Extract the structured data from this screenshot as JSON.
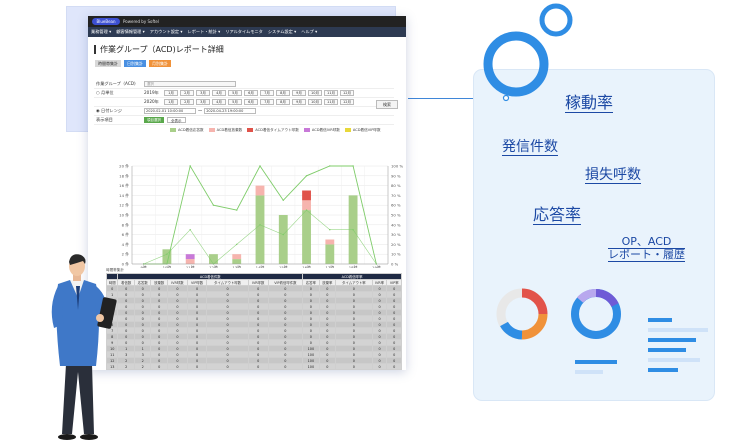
{
  "app": {
    "logo": "BlueBean",
    "title_tail": "Powered by Softel",
    "menu": [
      "業務管理 ▾",
      "顧客情報管理 ▾",
      "アカウント設定 ▾",
      "レポート・統計 ▾",
      "リアルタイムモニタ",
      "システム設定 ▾",
      "ヘルプ ▾"
    ]
  },
  "page": {
    "title": "作業グループ（ACD)レポート詳細",
    "buttons": {
      "time_agg": "時間帯集計",
      "daily_agg": "日別集計",
      "monthly_agg": "月別集計"
    }
  },
  "filter": {
    "group_label": "作業グループ（ACD)",
    "group_select_placeholder": "選択",
    "month_label": "月単位",
    "year1": "2019年",
    "year2": "2020年",
    "months": [
      "1月",
      "2月",
      "3月",
      "4月",
      "5月",
      "6月",
      "7月",
      "8月",
      "9月",
      "10月",
      "11月",
      "12月"
    ],
    "range_label": "日付レンジ",
    "range_from": "2020-02-01 10:00:00",
    "range_sep": "～",
    "range_to": "2020-04-23 19:00:00",
    "display_label": "表示項目",
    "select_btn": "項目選択",
    "all_btn": "全表示",
    "search_btn": "検索"
  },
  "chart_data": {
    "type": "bar",
    "categories": [
      "9時",
      "10時",
      "11時",
      "12時",
      "13時",
      "14時",
      "15時",
      "16時",
      "17時",
      "18時",
      "19時"
    ],
    "series": [
      {
        "name": "ACD着信応答数",
        "values": [
          0,
          3,
          0,
          2,
          1,
          14,
          10,
          11,
          4,
          14,
          0
        ]
      },
      {
        "name": "ACD着信放棄数",
        "values": [
          0,
          0,
          1,
          0,
          1,
          2,
          0,
          2,
          1,
          0,
          0
        ]
      },
      {
        "name": "ACD着信タイムアウト呼数",
        "values": [
          0,
          0,
          0,
          0,
          0,
          0,
          0,
          2,
          0,
          0,
          0
        ]
      },
      {
        "name": "ACD着信IVR呼数",
        "values": [
          0,
          0,
          1,
          0,
          0,
          0,
          0,
          0,
          0,
          0,
          0
        ]
      },
      {
        "name": "ACD着信VIP呼数",
        "values": [
          0,
          0,
          0,
          0,
          0,
          0,
          0,
          0,
          0,
          0,
          0
        ]
      }
    ],
    "ylim_left": [
      0,
      20
    ],
    "y_ticks_left": [
      "0 件",
      "2 件",
      "4 件",
      "6 件",
      "8 件",
      "10 件",
      "12 件",
      "14 件",
      "16 件",
      "18 件",
      "20 件"
    ],
    "ylim_right": [
      0,
      100
    ],
    "y_ticks_right": [
      "0 %",
      "10 %",
      "20 %",
      "30 %",
      "40 %",
      "50 %",
      "60 %",
      "70 %",
      "80 %",
      "90 %",
      "100 %"
    ],
    "rate_lines": [
      {
        "values": [
          0,
          0,
          100,
          60,
          55,
          100,
          65,
          90,
          100,
          100,
          0
        ]
      },
      {
        "values": [
          0,
          10,
          35,
          0,
          20,
          40,
          30,
          55,
          35,
          35,
          0
        ]
      }
    ],
    "grid": true,
    "legend": "top"
  },
  "table": {
    "caption": "時間帯集計",
    "group1": "ACD着信件数",
    "group2": "ACD着信呼率",
    "headers": [
      "時間",
      "着信数",
      "応答数",
      "放棄数",
      "IVR呼数",
      "VIP呼数",
      "タイムアウト呼数",
      "IVR呼数",
      "VIP着信呼件数",
      "応答率",
      "放棄率",
      "タイムアウト率",
      "IVR率",
      "VIP率"
    ],
    "rows": [
      [
        "0",
        "0",
        "0",
        "0",
        "0",
        "0",
        "0",
        "0",
        "0",
        "0",
        "0",
        "0",
        "0",
        "0"
      ],
      [
        "1",
        "0",
        "0",
        "0",
        "0",
        "0",
        "0",
        "0",
        "0",
        "0",
        "0",
        "0",
        "0",
        "0"
      ],
      [
        "2",
        "0",
        "0",
        "0",
        "0",
        "0",
        "0",
        "0",
        "0",
        "0",
        "0",
        "0",
        "0",
        "0"
      ],
      [
        "3",
        "0",
        "0",
        "0",
        "0",
        "0",
        "0",
        "0",
        "0",
        "0",
        "0",
        "0",
        "0",
        "0"
      ],
      [
        "4",
        "0",
        "0",
        "0",
        "0",
        "0",
        "0",
        "0",
        "0",
        "0",
        "0",
        "0",
        "0",
        "0"
      ],
      [
        "5",
        "0",
        "0",
        "0",
        "0",
        "0",
        "0",
        "0",
        "0",
        "0",
        "0",
        "0",
        "0",
        "0"
      ],
      [
        "6",
        "0",
        "0",
        "0",
        "0",
        "0",
        "0",
        "0",
        "0",
        "0",
        "0",
        "0",
        "0",
        "0"
      ],
      [
        "7",
        "0",
        "0",
        "0",
        "0",
        "0",
        "0",
        "0",
        "0",
        "0",
        "0",
        "0",
        "0",
        "0"
      ],
      [
        "8",
        "0",
        "0",
        "0",
        "0",
        "0",
        "0",
        "0",
        "0",
        "0",
        "0",
        "0",
        "0",
        "0"
      ],
      [
        "9",
        "0",
        "0",
        "0",
        "0",
        "0",
        "0",
        "0",
        "0",
        "0",
        "0",
        "0",
        "0",
        "0"
      ],
      [
        "10",
        "1",
        "1",
        "0",
        "0",
        "0",
        "0",
        "0",
        "0",
        "100",
        "0",
        "0",
        "0",
        "0"
      ],
      [
        "11",
        "3",
        "3",
        "0",
        "0",
        "0",
        "0",
        "0",
        "0",
        "100",
        "0",
        "0",
        "0",
        "0"
      ],
      [
        "12",
        "2",
        "2",
        "0",
        "0",
        "0",
        "0",
        "0",
        "0",
        "100",
        "0",
        "0",
        "0",
        "0"
      ],
      [
        "13",
        "2",
        "2",
        "0",
        "0",
        "0",
        "0",
        "0",
        "0",
        "100",
        "0",
        "0",
        "0",
        "0"
      ]
    ]
  },
  "promo": {
    "term_uptime": "稼動率",
    "term_outbound": "発信件数",
    "term_lost": "損失呼数",
    "term_answer": "応答率",
    "term_op_acd": "OP、ACD",
    "term_report": "レポート・履歴"
  },
  "colors": {
    "accent_blue": "#2f8de4",
    "term_blue": "#1c49a4",
    "bar_answer": "#a9cf8a",
    "bar_answer_dark": "#5cbf5c",
    "bar_abandon": "#f6b4ae",
    "bar_timeout": "#e0534a",
    "bar_ivr": "#c879d8",
    "bar_vip": "#e8d83a",
    "line_green": "#7fcc6a"
  }
}
